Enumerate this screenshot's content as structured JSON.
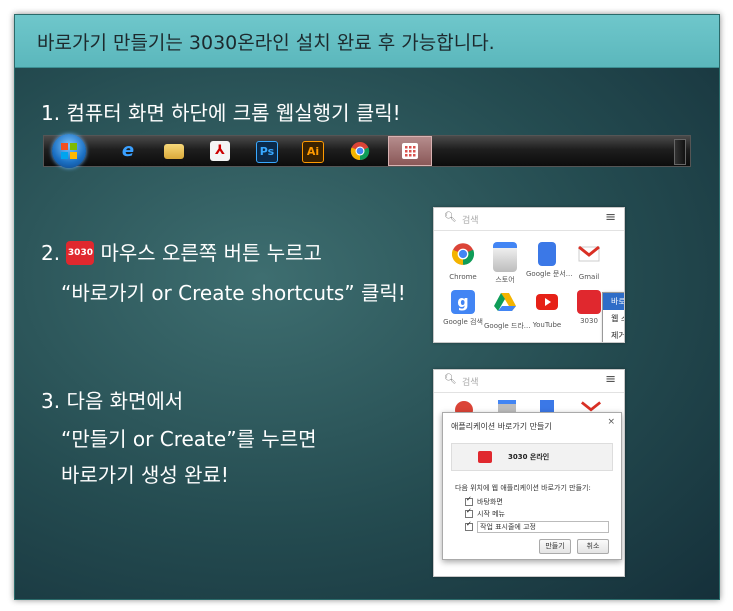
{
  "header": {
    "title": "바로가기 만들기는 3030온라인 설치 완료 후 가능합니다."
  },
  "steps": {
    "step1": "1. 컴퓨터 화면 하단에 크롬 웹실행기 클릭!",
    "step2_line1": "마우스 오른쪽 버튼 누르고",
    "step2_prefix": "2.",
    "step2_line2": "“바로가기 or Create shortcuts” 클릭!",
    "step3_line1": "3. 다음 화면에서",
    "step3_line2": "“만들기 or Create”를 누르면",
    "step3_line3": "바로가기 생성 완료!"
  },
  "badge_text": "3030",
  "taskbar": {
    "icons": [
      "windows-start-icon",
      "internet-explorer-icon",
      "file-explorer-icon",
      "acrobat-icon",
      "photoshop-icon",
      "illustrator-icon",
      "chrome-icon",
      "app-launcher-icon"
    ],
    "ps_label": "Ps",
    "ai_label": "Ai"
  },
  "launcher1": {
    "search_placeholder": "검색",
    "apps": [
      {
        "label": "Chrome",
        "color": "#dd4b39"
      },
      {
        "label": "스토어",
        "color": "#bdbdbd"
      },
      {
        "label": "Google 문서...",
        "color": "#3b78e7"
      },
      {
        "label": "Gmail",
        "color": "#d93025"
      },
      {
        "label": "Google 검색",
        "color": "#4285f4"
      },
      {
        "label": "Google 드라...",
        "color": "#0f9d58"
      },
      {
        "label": "YouTube",
        "color": "#e62117"
      },
      {
        "label": "3030",
        "color": "#e0282e"
      }
    ],
    "context_menu": [
      "바로가기 만들기...",
      "웹 스토어에서 보기",
      "제거"
    ]
  },
  "launcher2": {
    "search_placeholder": "검색",
    "dialog": {
      "title": "애플리케이션 바로가기 만들기",
      "app_name": "3030 온라인",
      "question": "다음 위치에 웹 애플리케이션 바로가기 만들기:",
      "options": [
        "바탕화면",
        "시작 메뉴",
        "작업 표시줄에 고정"
      ],
      "create_button": "만들기",
      "cancel_button": "취소"
    }
  }
}
